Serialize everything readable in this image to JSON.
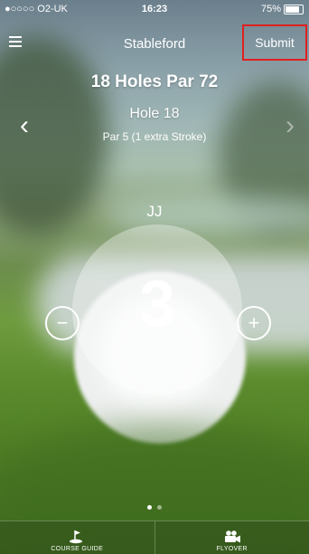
{
  "status_bar": {
    "carrier": "●○○○○ O2-UK",
    "time": "16:23",
    "battery": "75%"
  },
  "nav": {
    "title": "Stableford",
    "submit_label": "Submit"
  },
  "round": {
    "holes_title": "18 Holes Par 72",
    "hole_label": "Hole 18",
    "par_info": "Par 5 (1 extra Stroke)"
  },
  "scoring": {
    "player": "JJ",
    "score": "3",
    "minus_symbol": "−",
    "plus_symbol": "+"
  },
  "arrows": {
    "prev": "‹",
    "next": "›"
  },
  "pager": {
    "pages": 2,
    "active_index": 0
  },
  "tabbar": {
    "tabs": [
      {
        "label": "COURSE GUIDE",
        "icon": "flag-icon"
      },
      {
        "label": "FLYOVER",
        "icon": "video-camera-icon"
      }
    ]
  },
  "colors": {
    "highlight_border": "#e02020"
  }
}
